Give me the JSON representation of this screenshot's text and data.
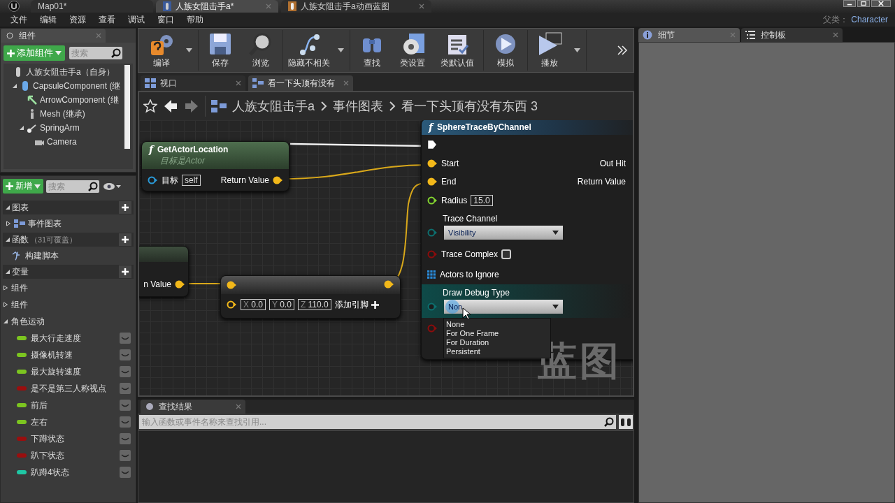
{
  "title_bar": {
    "tabs": [
      {
        "label": "Map01*",
        "kind": "level",
        "selected": false
      },
      {
        "label": "人族女阻击手a*",
        "kind": "blueprint",
        "selected": true
      },
      {
        "label": "人族女阻击手a动画蓝图",
        "kind": "anim",
        "selected": false
      }
    ]
  },
  "menu": [
    "文件",
    "编辑",
    "资源",
    "查看",
    "调试",
    "窗口",
    "帮助"
  ],
  "parent_class": {
    "label": "父类：",
    "value": "Character"
  },
  "components_panel": {
    "tab": "组件",
    "add_button": "添加组件",
    "search": {
      "placeholder": "搜索"
    },
    "tree": [
      {
        "label": "人族女阻击手a（自身）",
        "kind": "actor",
        "children": [
          {
            "label": "CapsuleComponent (继",
            "kind": "capsule",
            "expanded": true,
            "children": [
              {
                "label": "ArrowComponent (继",
                "kind": "arrow"
              },
              {
                "label": "Mesh (继承)",
                "kind": "mesh"
              },
              {
                "label": "SpringArm",
                "kind": "spring_arm",
                "expanded": true,
                "children": [
                  {
                    "label": "Camera",
                    "kind": "camera"
                  }
                ]
              }
            ]
          }
        ]
      }
    ]
  },
  "my_blueprint": {
    "add_button": "新增",
    "search": {
      "placeholder": "搜索"
    },
    "sections": [
      {
        "title": "图表",
        "expanded": true,
        "items": [
          {
            "label": "事件图表",
            "kind": "graph",
            "expanded": false
          }
        ]
      },
      {
        "title": "函数",
        "count": "（31可覆盖）",
        "expanded": true,
        "items": [
          {
            "label": "构建脚本",
            "kind": "function"
          }
        ]
      },
      {
        "title": "变量",
        "expanded": true,
        "items": [
          {
            "label": "组件",
            "kind": "category",
            "expanded": false
          },
          {
            "label": "组件",
            "kind": "category",
            "expanded": false
          },
          {
            "label": "角色运动",
            "kind": "category",
            "expanded": true,
            "children": [
              {
                "label": "最大行走速度",
                "color": "#7cc520"
              },
              {
                "label": "摄像机转速",
                "color": "#7cc520"
              },
              {
                "label": "最大旋转速度",
                "color": "#7cc520"
              },
              {
                "label": "是不是第三人称视点",
                "color": "#9a0e0e"
              },
              {
                "label": "前后",
                "color": "#7cc520"
              },
              {
                "label": "左右",
                "color": "#7cc520"
              },
              {
                "label": "下蹲状态",
                "color": "#9a0e0e"
              },
              {
                "label": "趴下状态",
                "color": "#9a0e0e"
              },
              {
                "label": "趴蹲4状态",
                "color": "#1fc7a4"
              }
            ]
          }
        ]
      }
    ]
  },
  "toolbar": [
    {
      "items": [
        {
          "label": "编译",
          "kind": "compile",
          "dropdown": true
        }
      ]
    },
    {
      "items": [
        {
          "label": "保存",
          "kind": "save"
        },
        {
          "label": "浏览",
          "kind": "browse"
        }
      ]
    },
    {
      "items": [
        {
          "label": "隐藏不相关",
          "kind": "hide",
          "dropdown": true
        }
      ]
    },
    {
      "items": [
        {
          "label": "查找",
          "kind": "find"
        },
        {
          "label": "类设置",
          "kind": "class_settings"
        },
        {
          "label": "类默认值",
          "kind": "class_defaults"
        }
      ]
    },
    {
      "items": [
        {
          "label": "模拟",
          "kind": "simulate"
        }
      ]
    },
    {
      "items": [
        {
          "label": "播放",
          "kind": "play",
          "dropdown": true
        }
      ]
    }
  ],
  "editor_tabs": [
    {
      "label": "视口",
      "kind": "viewport",
      "selected": false
    },
    {
      "label": "看一下头顶有没有",
      "kind": "graph",
      "selected": true
    }
  ],
  "graph": {
    "breadcrumb": [
      "人族女阻击手a",
      "事件图表",
      "看一下头顶有没有东西 3"
    ],
    "get_actor_location": {
      "icon_glyph": "f",
      "title": "GetActorLocation",
      "subtitle": "目标是Actor",
      "target_label": "目标",
      "target_value": "self",
      "output": "Return Value"
    },
    "partial_node": {
      "output": "n Value"
    },
    "make_vector": {
      "fields": [
        {
          "axis": "X",
          "value": "0.0"
        },
        {
          "axis": "Y",
          "value": "0.0"
        },
        {
          "axis": "Z",
          "value": "110.0"
        }
      ],
      "add_pin": "添加引脚"
    },
    "sphere_trace": {
      "icon_glyph": "f",
      "title": "SphereTraceByChannel",
      "inputs": [
        {
          "kind": "exec",
          "connected": true
        },
        {
          "kind": "vector",
          "label": "Start",
          "connected": true
        },
        {
          "kind": "vector",
          "label": "End",
          "connected": true
        },
        {
          "kind": "float",
          "label": "Radius",
          "value": "15.0",
          "connected": false
        },
        {
          "kind": "enum",
          "label": "Trace Channel",
          "value": "Visibility",
          "connected": false
        },
        {
          "kind": "bool",
          "label": "Trace Complex",
          "checked": false,
          "connected": false
        },
        {
          "kind": "array",
          "label": "Actors to Ignore"
        },
        {
          "kind": "enum",
          "label": "Draw Debug Type",
          "value": "Non",
          "connected": false,
          "hovered": true
        },
        {
          "kind": "bool",
          "connected": false
        }
      ],
      "outputs": [
        "Out Hit",
        "Return Value"
      ]
    },
    "dropdown": [
      "None",
      "For One Frame",
      "For Duration",
      "Persistent"
    ],
    "watermark": "蓝图"
  },
  "find_results": {
    "tab": "查找结果",
    "search": {
      "placeholder": "输入函数或事件名称来查找引用..."
    }
  },
  "right_tabs": [
    {
      "label": "细节",
      "kind": "details",
      "selected": true
    },
    {
      "label": "控制板",
      "kind": "palette",
      "selected": false
    }
  ]
}
